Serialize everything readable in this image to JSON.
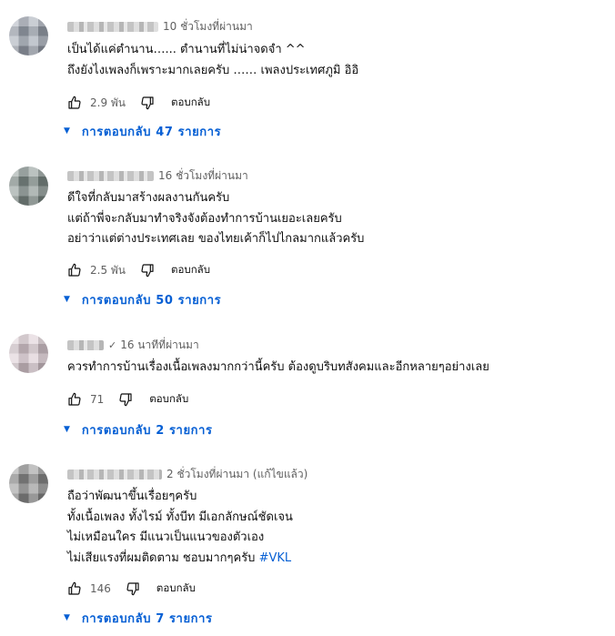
{
  "comments": [
    {
      "time": "10 ชั่วโมงที่ผ่านมา",
      "lines": [
        "เป็นได้แค่ตำนาน…... ตำนานที่ไม่น่าจดจำ ^^",
        "ถึงยังไงเพลงก็เพราะมากเลยครับ …… เพลงประเทศภูมิ อิอิ"
      ],
      "likes": "2.9 พัน",
      "reply_label": "ตอบกลับ",
      "replies_label": "การตอบกลับ 47 รายการ"
    },
    {
      "time": "16 ชั่วโมงที่ผ่านมา",
      "lines": [
        "ดีใจที่กลับมาสร้างผลงานกันครับ",
        "แต่ถ้าพี่จะกลับมาทำจริงจังต้องทำการบ้านเยอะเลยครับ",
        "อย่าว่าแต่ต่างประเทศเลย ของไทยเค้าก็ไปไกลมากแล้วครับ"
      ],
      "likes": "2.5 พัน",
      "reply_label": "ตอบกลับ",
      "replies_label": "การตอบกลับ 50 รายการ"
    },
    {
      "time": "16 นาทีที่ผ่านมา",
      "check": "✓",
      "lines": [
        "ควรทำการบ้านเรื่องเนื้อเพลงมากกว่านี้ครับ  ต้องดูบริบทสังคมและอีกหลายๆอย่างเลย"
      ],
      "likes": "71",
      "reply_label": "ตอบกลับ",
      "replies_label": "การตอบกลับ 2 รายการ"
    },
    {
      "time": "2 ชั่วโมงที่ผ่านมา (แก้ไขแล้ว)",
      "lines": [
        "ถือว่าพัฒนาขึ้นเรื่อยๆครับ",
        "ทั้งเนื้อเพลง ทั้งไรม์ ทั้งบีท มีเอกลักษณ์ชัดเจน",
        "ไม่เหมือนใคร มีแนวเป็นแนวของตัวเอง",
        "ไม่เสียแรงที่ผมติดตาม ชอบมากๆครับ "
      ],
      "hashtag": "#VKL",
      "likes": "146",
      "reply_label": "ตอบกลับ",
      "replies_label": "การตอบกลับ 7 รายการ"
    }
  ],
  "icons": {
    "like": "thumbs-up-icon",
    "dislike": "thumbs-down-icon",
    "caret": "caret-down-icon"
  },
  "colors": {
    "link": "#065fd4",
    "meta": "#606060",
    "text": "#0f0f0f"
  }
}
